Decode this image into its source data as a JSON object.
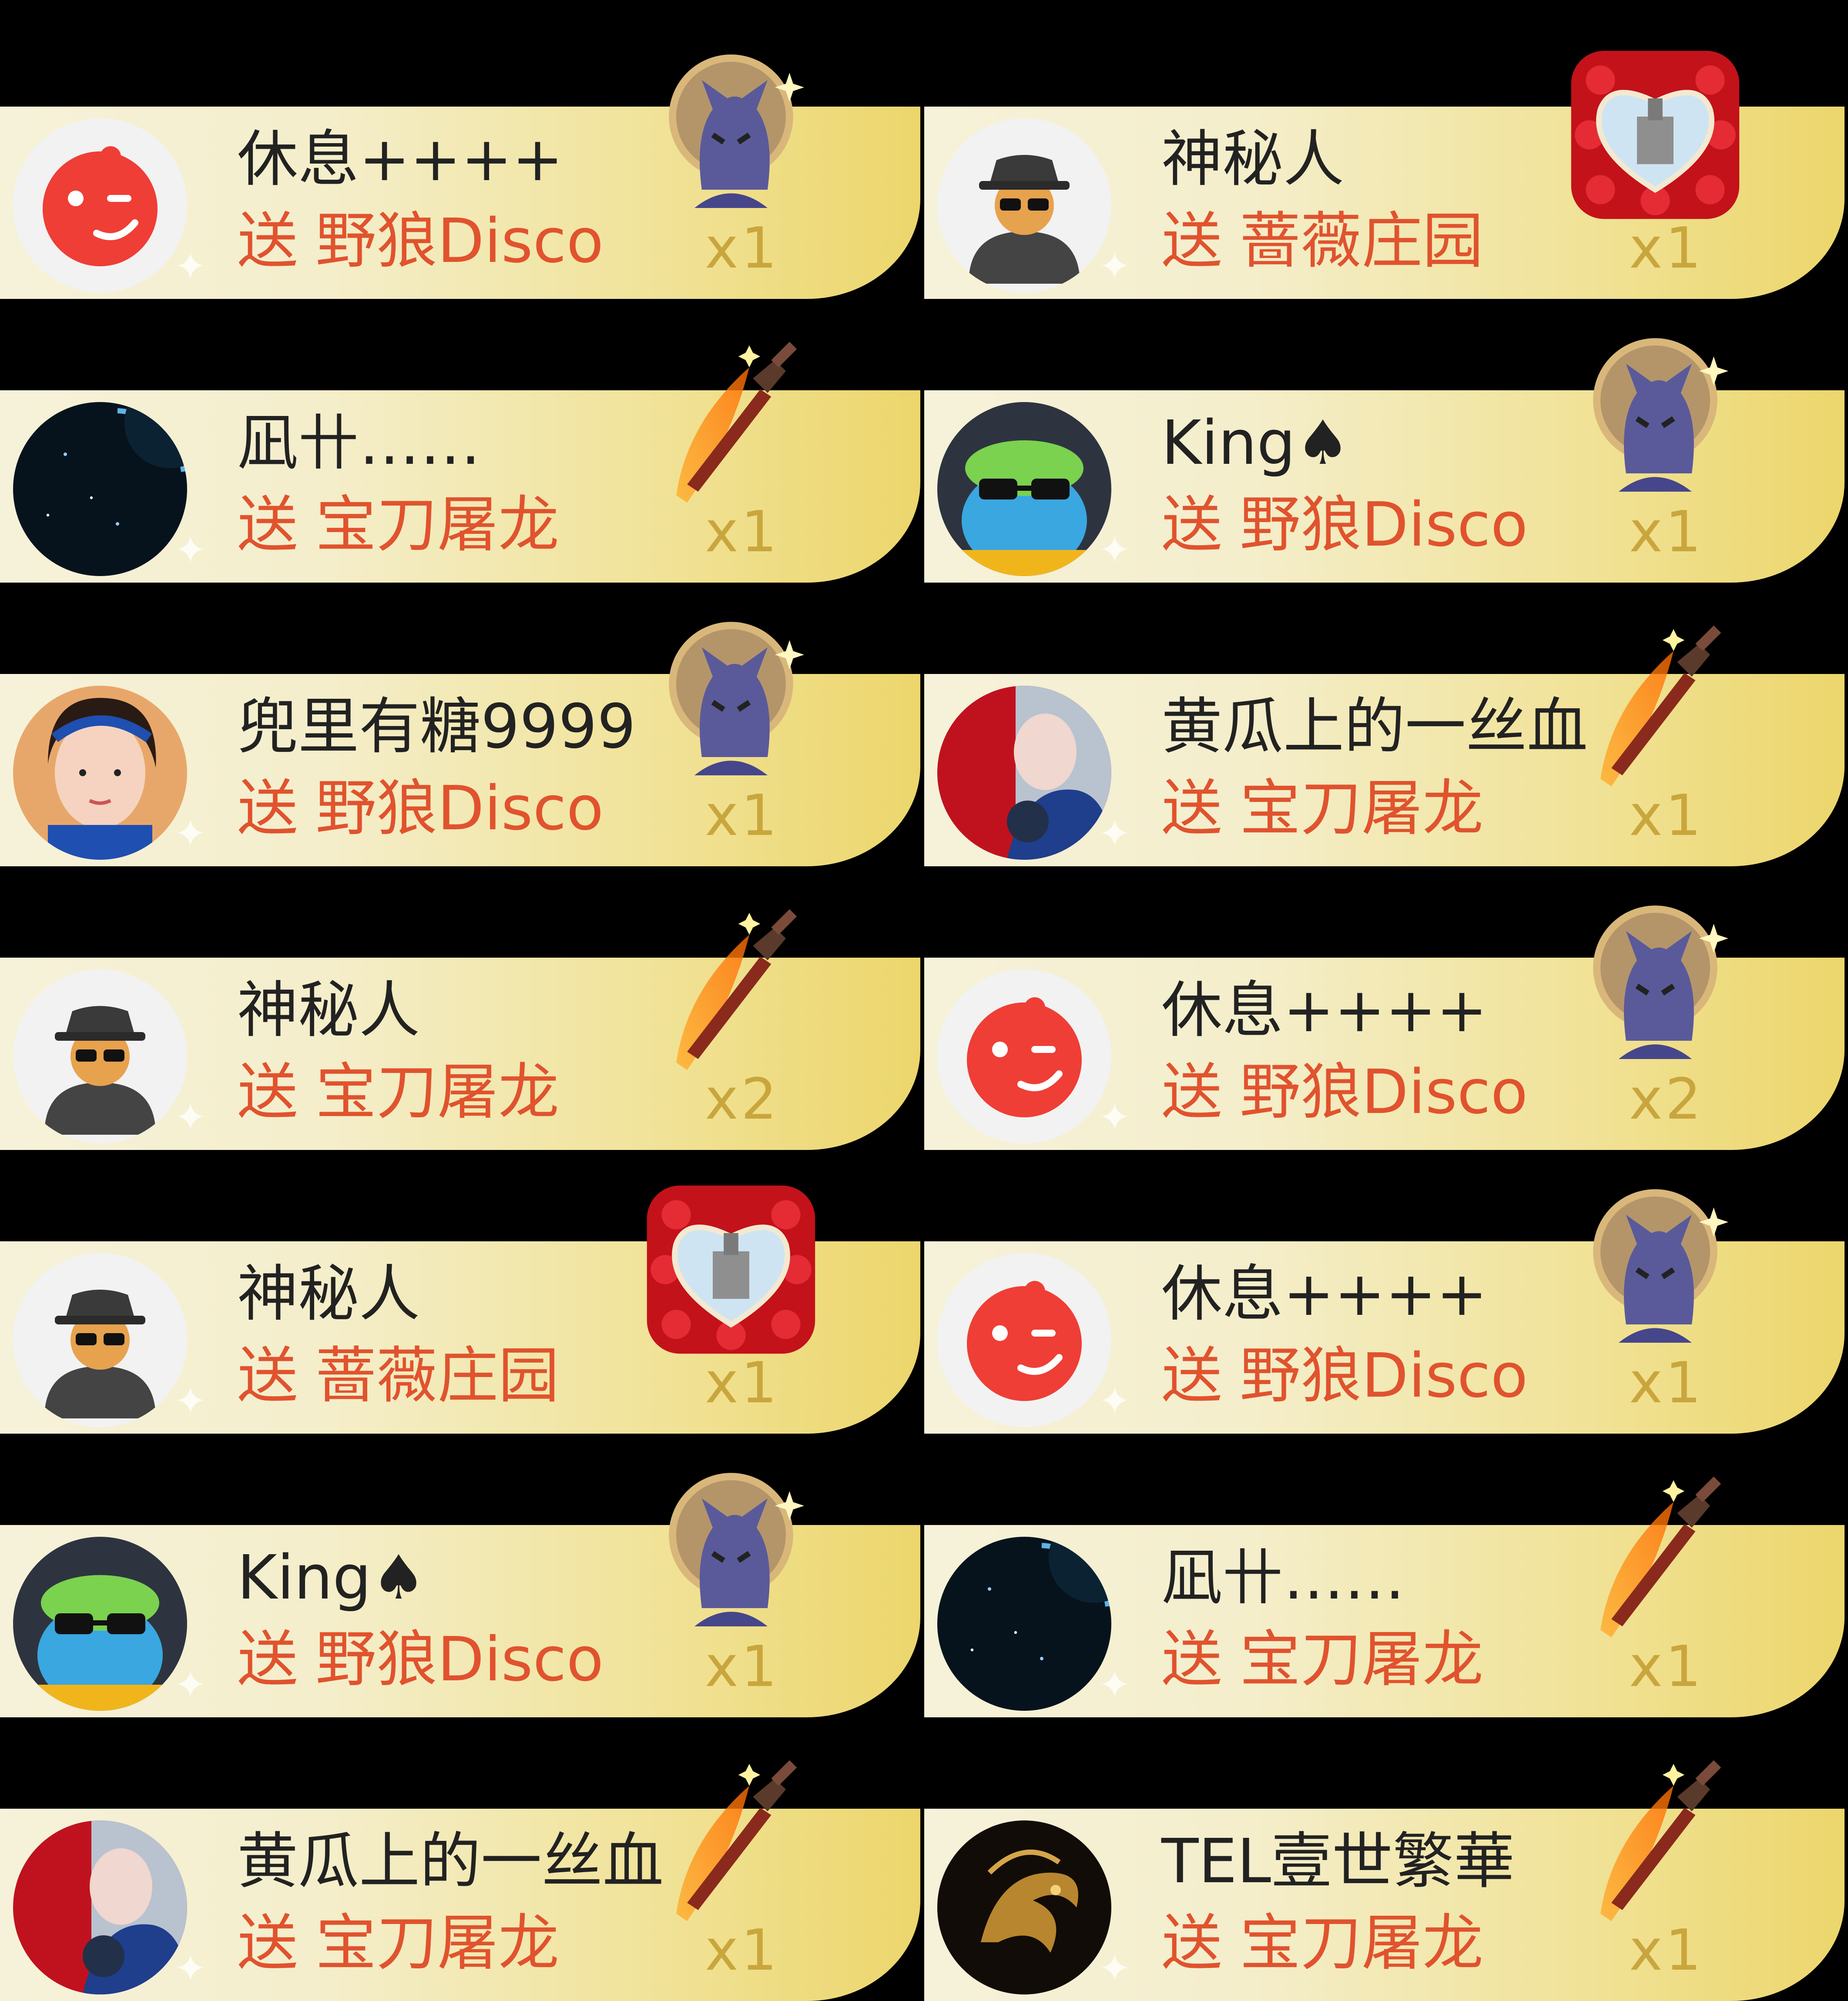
{
  "colors": {
    "background": "#000000",
    "gift_text": "#e0532e",
    "count_text": "#c9a63d",
    "name_text": "#222222"
  },
  "left_column": [
    {
      "name": "休息++++",
      "send": "送",
      "gift": "野狼Disco",
      "count": "x1",
      "avatar_icon": "red-wink-face-avatar",
      "gift_icon": "wolf-disco-icon"
    },
    {
      "name": "凪卄……",
      "send": "送",
      "gift": "宝刀屠龙",
      "count": "x1",
      "avatar_icon": "planet-space-avatar",
      "gift_icon": "dragon-sword-icon"
    },
    {
      "name": "兜里有糖9999",
      "send": "送",
      "gift": "野狼Disco",
      "count": "x1",
      "avatar_icon": "girl-photo-avatar",
      "gift_icon": "wolf-disco-icon"
    },
    {
      "name": "神秘人",
      "send": "送",
      "gift": "宝刀屠龙",
      "count": "x2",
      "avatar_icon": "mystery-man-avatar",
      "gift_icon": "dragon-sword-icon"
    },
    {
      "name": "神秘人",
      "send": "送",
      "gift": "蔷薇庄园",
      "count": "x1",
      "avatar_icon": "mystery-man-avatar",
      "gift_icon": "rose-manor-icon"
    },
    {
      "name": "King♠",
      "send": "送",
      "gift": "野狼Disco",
      "count": "x1",
      "avatar_icon": "frog-sunglasses-avatar",
      "gift_icon": "wolf-disco-icon"
    },
    {
      "name": "黄瓜上的一丝血",
      "send": "送",
      "gift": "宝刀屠龙",
      "count": "x1",
      "avatar_icon": "red-photo-avatar",
      "gift_icon": "dragon-sword-icon"
    }
  ],
  "right_column": [
    {
      "name": "神秘人",
      "send": "送",
      "gift": "蔷薇庄园",
      "count": "x1",
      "avatar_icon": "mystery-man-avatar",
      "gift_icon": "rose-manor-icon"
    },
    {
      "name": "King♠",
      "send": "送",
      "gift": "野狼Disco",
      "count": "x1",
      "avatar_icon": "frog-sunglasses-avatar",
      "gift_icon": "wolf-disco-icon"
    },
    {
      "name": "黄瓜上的一丝血",
      "send": "送",
      "gift": "宝刀屠龙",
      "count": "x1",
      "avatar_icon": "red-photo-avatar",
      "gift_icon": "dragon-sword-icon"
    },
    {
      "name": "休息++++",
      "send": "送",
      "gift": "野狼Disco",
      "count": "x2",
      "avatar_icon": "red-wink-face-avatar",
      "gift_icon": "wolf-disco-icon"
    },
    {
      "name": "休息++++",
      "send": "送",
      "gift": "野狼Disco",
      "count": "x1",
      "avatar_icon": "red-wink-face-avatar",
      "gift_icon": "wolf-disco-icon"
    },
    {
      "name": "凪卄……",
      "send": "送",
      "gift": "宝刀屠龙",
      "count": "x1",
      "avatar_icon": "planet-space-avatar",
      "gift_icon": "dragon-sword-icon"
    },
    {
      "name": "TEL壹世繁華",
      "send": "送",
      "gift": "宝刀屠龙",
      "count": "x1",
      "avatar_icon": "gold-dragon-avatar",
      "gift_icon": "dragon-sword-icon"
    }
  ]
}
